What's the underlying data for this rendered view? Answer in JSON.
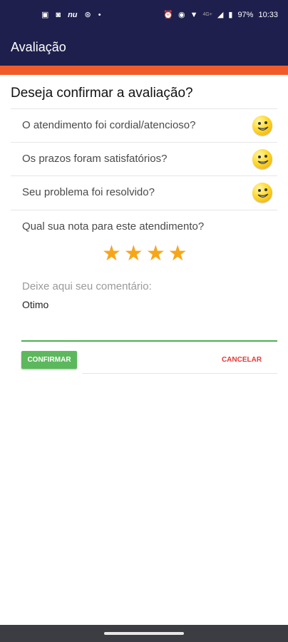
{
  "status_bar": {
    "left_icons": [
      "app-icon",
      "notification-icon",
      "nu-icon",
      "cast-icon",
      "dot-icon"
    ],
    "nu_text": "nu",
    "battery": "97%",
    "time": "10:33",
    "network": "4G+"
  },
  "app_bar": {
    "title": "Avaliação"
  },
  "form": {
    "heading": "Deseja confirmar a avaliação?",
    "questions": [
      {
        "label": "O atendimento foi cordial/atencioso?",
        "icon": "smiley-icon"
      },
      {
        "label": "Os prazos foram satisfatórios?",
        "icon": "smiley-icon"
      },
      {
        "label": "Seu problema foi resolvido?",
        "icon": "smiley-icon"
      }
    ],
    "rating_question": "Qual sua nota para este atendimento?",
    "rating": {
      "value": 4,
      "max": 4
    },
    "comment_label": "Deixe aqui seu comentário:",
    "comment_value": "Otimo"
  },
  "actions": {
    "confirm_label": "CONFIRMAR",
    "cancel_label": "CANCELAR"
  },
  "colors": {
    "header_bg": "#1e1f4d",
    "accent": "#f15a2b",
    "star": "#f7a619",
    "confirm_bg": "#5cb85c",
    "cancel_text": "#e53935",
    "underline": "#4caf50"
  }
}
